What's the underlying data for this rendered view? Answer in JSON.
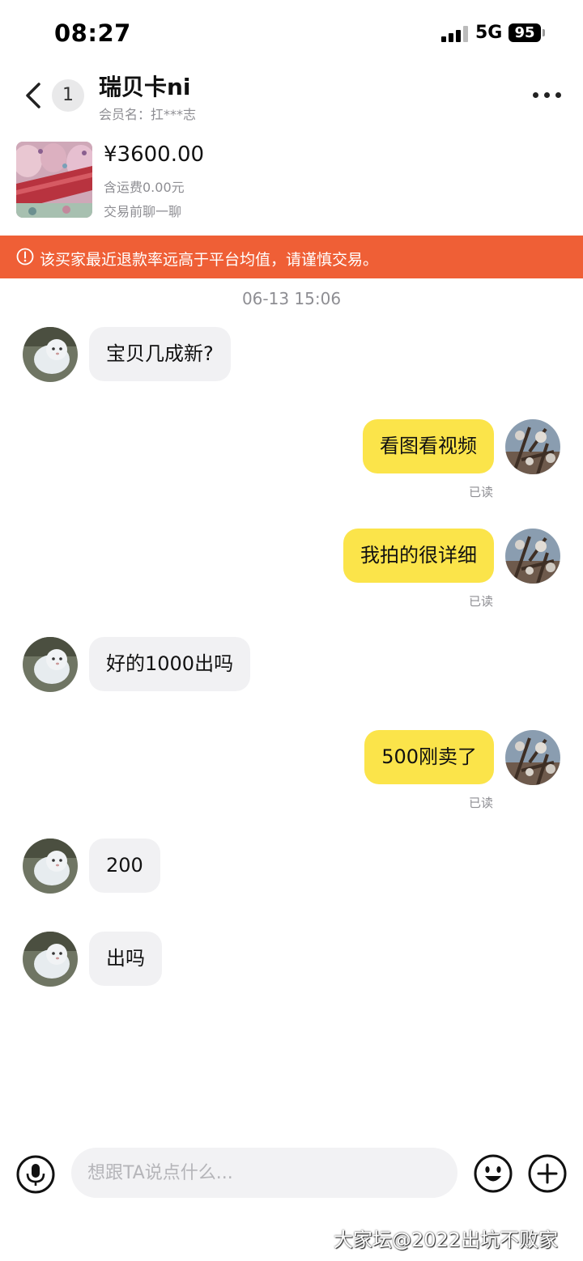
{
  "status_bar": {
    "time": "08:27",
    "network": "5G",
    "battery": "95"
  },
  "header": {
    "unread_count": "1",
    "contact_name": "瑞贝卡ni",
    "member_label": "会员名：扛***志"
  },
  "product": {
    "price": "¥3600.00",
    "shipping": "含运费0.00元",
    "hint": "交易前聊一聊"
  },
  "warning": {
    "text": "该买家最近退款率远高于平台均值，请谨慎交易。"
  },
  "chat": {
    "timestamp": "06-13 15:06",
    "read_label": "已读",
    "messages": [
      {
        "side": "in",
        "text": "宝贝几成新?"
      },
      {
        "side": "out",
        "text": "看图看视频"
      },
      {
        "side": "out",
        "text": "我拍的很详细"
      },
      {
        "side": "in",
        "text": "好的1000出吗"
      },
      {
        "side": "out",
        "text": "500刚卖了"
      },
      {
        "side": "in",
        "text": "200"
      },
      {
        "side": "in",
        "text": "出吗"
      }
    ]
  },
  "input": {
    "placeholder": "想跟TA说点什么..."
  },
  "watermark": "大家坛@2022出坑不败家",
  "colors": {
    "warning_bg": "#ef5f36",
    "out_bubble": "#fbe44a",
    "in_bubble": "#f1f1f3"
  },
  "icons": [
    "back-icon",
    "more-icon",
    "warning-icon",
    "microphone-icon",
    "emoji-icon",
    "plus-icon"
  ]
}
